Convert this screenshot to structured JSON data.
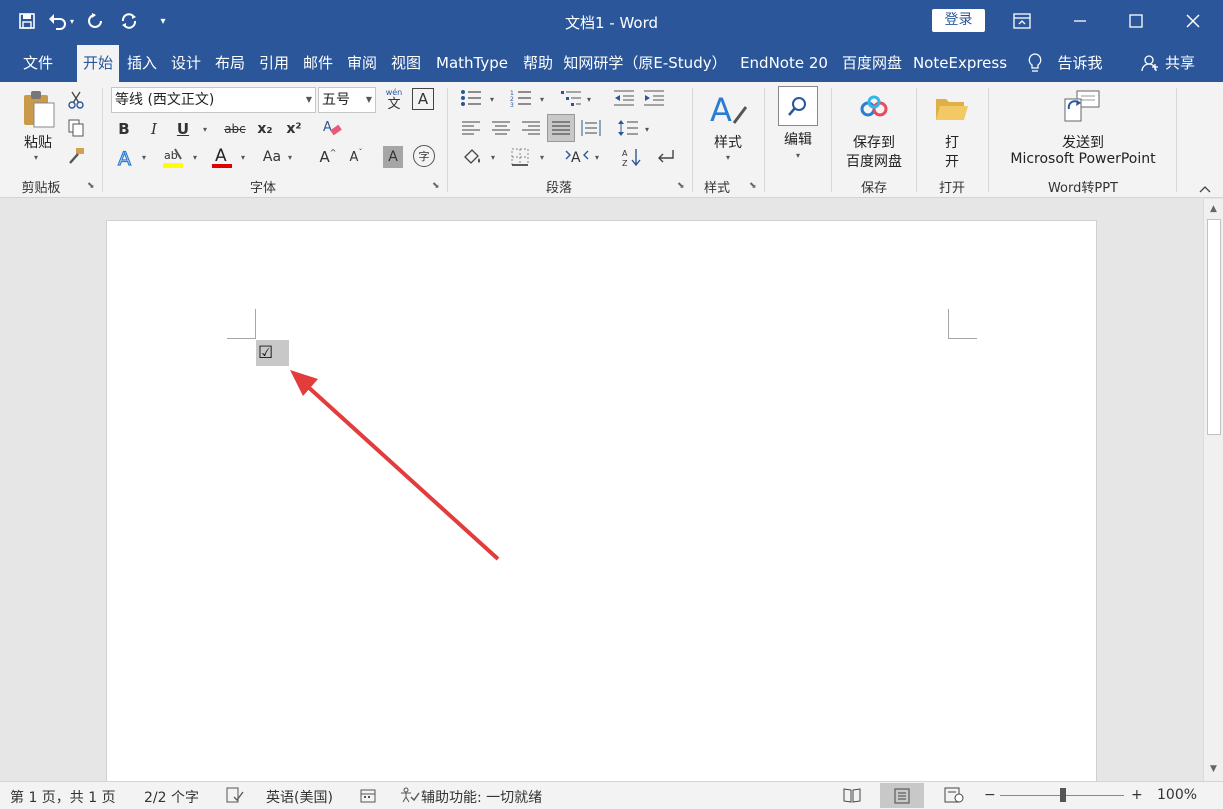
{
  "window": {
    "title": "文档1  -  Word",
    "login_label": "登录"
  },
  "tabs": [
    "文件",
    "开始",
    "插入",
    "设计",
    "布局",
    "引用",
    "邮件",
    "审阅",
    "视图",
    "MathType",
    "帮助",
    "知网研学（原E-Study）",
    "EndNote 20",
    "百度网盘",
    "NoteExpress",
    "告诉我",
    "共享"
  ],
  "active_tab": "开始",
  "ribbon": {
    "clipboard": {
      "paste": "粘贴",
      "label": "剪贴板"
    },
    "font": {
      "font_name": "等线 (西文正文)",
      "font_size": "五号",
      "label": "字体",
      "bold": "B",
      "italic": "I",
      "underline": "U",
      "strike": "abc",
      "sub": "x₂",
      "sup": "x²",
      "case": "Aa",
      "grow": "A",
      "shrink": "A",
      "pinyin": "wén",
      "pinyin_char": "文",
      "border_char": "A",
      "shade_char": "A",
      "enclose_char": "字"
    },
    "paragraph": {
      "label": "段落"
    },
    "styles": {
      "btn": "样式",
      "label": "样式"
    },
    "editing": {
      "btn": "编辑"
    },
    "save": {
      "btn_line1": "保存到",
      "btn_line2": "百度网盘",
      "label": "保存"
    },
    "open": {
      "btn_line1": "打",
      "btn_line2": "开",
      "label": "打开"
    },
    "ppt": {
      "btn_line1": "发送到",
      "btn_line2": "Microsoft PowerPoint",
      "label": "Word转PPT"
    }
  },
  "document": {
    "content": "☑"
  },
  "statusbar": {
    "page": "第 1 页，共 1 页",
    "words": "2/2 个字",
    "language": "英语(美国)",
    "accessibility": "辅助功能: 一切就绪",
    "zoom": "100%",
    "zoom_minus": "−",
    "zoom_plus": "+"
  },
  "colors": {
    "brand": "#2b579a",
    "ribbon_bg": "#f3f3f3",
    "highlight": "#ffff00",
    "font_color": "#e00000"
  }
}
